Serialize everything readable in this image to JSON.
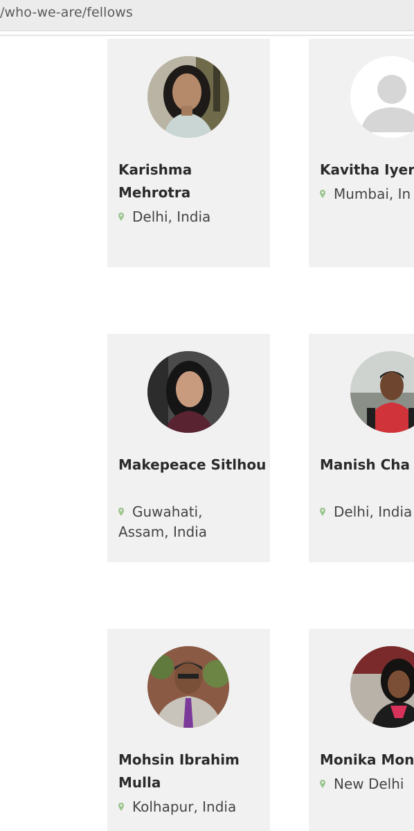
{
  "browser": {
    "url": "/who-we-are/fellows"
  },
  "colors": {
    "card_bg": "#f1f1f1",
    "pin_green": "#9bc58f",
    "name_text": "#2a2a2a",
    "location_text": "#444444"
  },
  "fellows": [
    {
      "name": "Karishma Mehrotra",
      "location": "Delhi, India",
      "photo": "portrait-photo"
    },
    {
      "name": "Kavitha Iyer",
      "location": "Mumbai, In",
      "photo": "default-user-icon"
    },
    {
      "name": "Makepeace Sitlhou",
      "location": "Guwahati, Assam, India",
      "photo": "portrait-photo"
    },
    {
      "name": "Manish Cha Mishra",
      "location": "Delhi, India",
      "photo": "portrait-photo"
    },
    {
      "name": "Mohsin Ibrahim Mulla",
      "location": "Kolhapur, India",
      "photo": "portrait-photo"
    },
    {
      "name": "Monika Mon",
      "location": "New Delhi",
      "photo": "portrait-photo"
    }
  ]
}
